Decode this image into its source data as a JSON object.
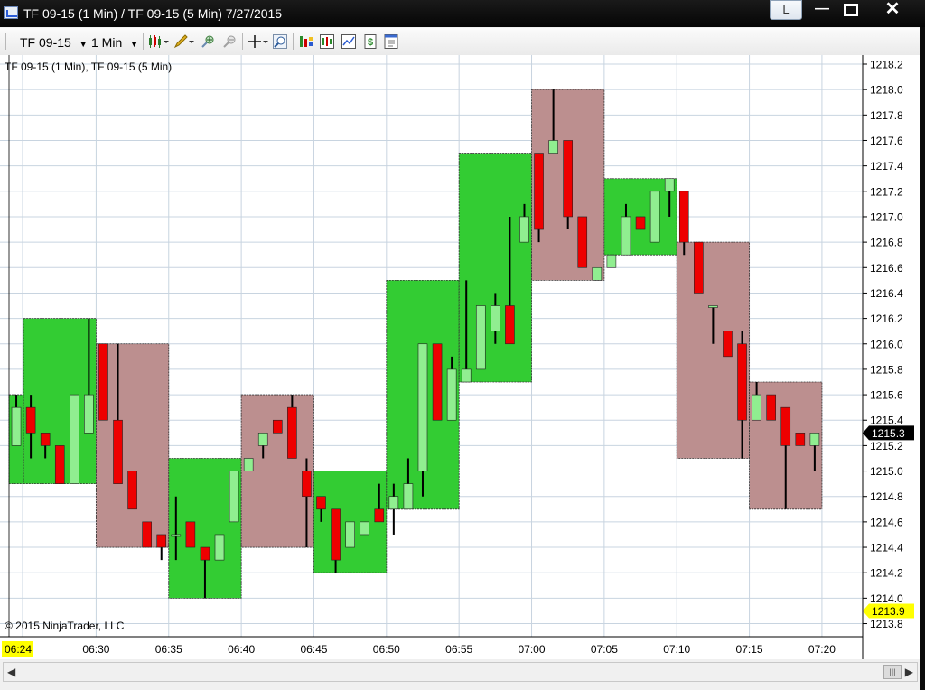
{
  "window": {
    "title": "TF 09-15 (1 Min) / TF 09-15 (5 Min)  7/27/2015",
    "l_button": "L"
  },
  "toolbar": {
    "instrument": "TF 09-15",
    "interval": "1 Min",
    "icons": [
      "chart-style-icon",
      "drawing-tools-icon",
      "zoom-in-icon",
      "zoom-out-icon",
      "crosshair-icon",
      "magnifier-icon",
      "chart-trader-icon",
      "data-box-icon",
      "indicators-icon",
      "strategies-icon",
      "properties-icon"
    ]
  },
  "chart": {
    "label": "TF 09-15 (1 Min), TF 09-15 (5 Min)",
    "copyright": "© 2015 NinjaTrader, LLC",
    "last_price_label": "1215.3",
    "marker_label": "1213.9",
    "start_time_label": "06:24",
    "colors": {
      "up_box": "#33cc33",
      "down_box": "#bc8f8f",
      "up_candle": "#90ee90",
      "down_candle": "#ee0000",
      "grid": "#c8d4e0",
      "price_tag": "#000000",
      "marker_tag": "#ffff00"
    }
  },
  "chart_data": {
    "type": "candlestick",
    "title": "",
    "y_ticks": [
      1218.2,
      1218.0,
      1217.8,
      1217.6,
      1217.4,
      1217.2,
      1217.0,
      1216.8,
      1216.6,
      1216.4,
      1216.2,
      1216.0,
      1215.8,
      1215.6,
      1215.4,
      1215.2,
      1215.0,
      1214.8,
      1214.6,
      1214.4,
      1214.2,
      1214.0,
      1213.8
    ],
    "x_ticks": [
      "06:30",
      "06:35",
      "06:40",
      "06:45",
      "06:50",
      "06:55",
      "07:00",
      "07:05",
      "07:10",
      "07:15",
      "07:20"
    ],
    "ylim": [
      1213.75,
      1218.3
    ],
    "five_min_bars": [
      {
        "start": "06:24",
        "end": "06:25",
        "open": 1214.9,
        "close": 1215.6,
        "dir": "up"
      },
      {
        "start": "06:25",
        "end": "06:30",
        "open": 1214.9,
        "close": 1216.2,
        "dir": "up"
      },
      {
        "start": "06:30",
        "end": "06:35",
        "open": 1216.0,
        "close": 1214.4,
        "dir": "down"
      },
      {
        "start": "06:35",
        "end": "06:40",
        "open": 1214.0,
        "close": 1215.1,
        "dir": "up"
      },
      {
        "start": "06:40",
        "end": "06:45",
        "open": 1215.6,
        "close": 1214.4,
        "dir": "down"
      },
      {
        "start": "06:45",
        "end": "06:50",
        "open": 1214.2,
        "close": 1215.0,
        "dir": "up"
      },
      {
        "start": "06:50",
        "end": "06:55",
        "open": 1214.7,
        "close": 1216.5,
        "dir": "up"
      },
      {
        "start": "06:55",
        "end": "07:00",
        "open": 1215.7,
        "close": 1217.5,
        "dir": "up"
      },
      {
        "start": "07:00",
        "end": "07:05",
        "open": 1218.0,
        "close": 1216.5,
        "dir": "down"
      },
      {
        "start": "07:05",
        "end": "07:10",
        "open": 1216.7,
        "close": 1217.3,
        "dir": "up"
      },
      {
        "start": "07:10",
        "end": "07:15",
        "open": 1216.8,
        "close": 1215.1,
        "dir": "down"
      },
      {
        "start": "07:15",
        "end": "07:20",
        "open": 1215.7,
        "close": 1214.7,
        "dir": "down"
      }
    ],
    "one_min_bars": [
      {
        "t": "06:24",
        "o": 1215.2,
        "h": 1215.6,
        "l": 1215.2,
        "c": 1215.5
      },
      {
        "t": "06:25",
        "o": 1215.5,
        "h": 1215.6,
        "l": 1215.1,
        "c": 1215.3
      },
      {
        "t": "06:26",
        "o": 1215.3,
        "h": 1215.3,
        "l": 1215.1,
        "c": 1215.2
      },
      {
        "t": "06:27",
        "o": 1215.2,
        "h": 1215.2,
        "l": 1214.9,
        "c": 1214.9
      },
      {
        "t": "06:28",
        "o": 1214.9,
        "h": 1215.6,
        "l": 1214.9,
        "c": 1215.6
      },
      {
        "t": "06:29",
        "o": 1215.3,
        "h": 1216.2,
        "l": 1215.3,
        "c": 1215.6
      },
      {
        "t": "06:30",
        "o": 1216.0,
        "h": 1216.0,
        "l": 1215.4,
        "c": 1215.4
      },
      {
        "t": "06:31",
        "o": 1215.4,
        "h": 1216.0,
        "l": 1214.9,
        "c": 1214.9
      },
      {
        "t": "06:32",
        "o": 1215.0,
        "h": 1215.0,
        "l": 1214.7,
        "c": 1214.7
      },
      {
        "t": "06:33",
        "o": 1214.6,
        "h": 1214.6,
        "l": 1214.5,
        "c": 1214.4
      },
      {
        "t": "06:34",
        "o": 1214.5,
        "h": 1214.5,
        "l": 1214.3,
        "c": 1214.4
      },
      {
        "t": "06:35",
        "o": 1214.5,
        "h": 1214.8,
        "l": 1214.3,
        "c": 1214.5
      },
      {
        "t": "06:36",
        "o": 1214.6,
        "h": 1214.6,
        "l": 1214.4,
        "c": 1214.4
      },
      {
        "t": "06:37",
        "o": 1214.4,
        "h": 1214.4,
        "l": 1214.0,
        "c": 1214.3
      },
      {
        "t": "06:38",
        "o": 1214.3,
        "h": 1214.5,
        "l": 1214.3,
        "c": 1214.5
      },
      {
        "t": "06:39",
        "o": 1214.6,
        "h": 1215.0,
        "l": 1214.6,
        "c": 1215.0
      },
      {
        "t": "06:40",
        "o": 1215.0,
        "h": 1215.1,
        "l": 1215.0,
        "c": 1215.1
      },
      {
        "t": "06:41",
        "o": 1215.2,
        "h": 1215.3,
        "l": 1215.1,
        "c": 1215.3
      },
      {
        "t": "06:42",
        "o": 1215.4,
        "h": 1215.4,
        "l": 1215.3,
        "c": 1215.3
      },
      {
        "t": "06:43",
        "o": 1215.5,
        "h": 1215.6,
        "l": 1215.1,
        "c": 1215.1
      },
      {
        "t": "06:44",
        "o": 1215.0,
        "h": 1215.1,
        "l": 1214.4,
        "c": 1214.8
      },
      {
        "t": "06:45",
        "o": 1214.8,
        "h": 1214.8,
        "l": 1214.6,
        "c": 1214.7
      },
      {
        "t": "06:46",
        "o": 1214.7,
        "h": 1214.7,
        "l": 1214.2,
        "c": 1214.3
      },
      {
        "t": "06:47",
        "o": 1214.4,
        "h": 1214.6,
        "l": 1214.4,
        "c": 1214.6
      },
      {
        "t": "06:48",
        "o": 1214.5,
        "h": 1214.6,
        "l": 1214.5,
        "c": 1214.6
      },
      {
        "t": "06:49",
        "o": 1214.7,
        "h": 1214.9,
        "l": 1214.6,
        "c": 1214.6
      },
      {
        "t": "06:50",
        "o": 1214.7,
        "h": 1214.9,
        "l": 1214.5,
        "c": 1214.8
      },
      {
        "t": "06:51",
        "o": 1214.7,
        "h": 1215.1,
        "l": 1214.7,
        "c": 1214.9
      },
      {
        "t": "06:52",
        "o": 1215.0,
        "h": 1216.0,
        "l": 1214.8,
        "c": 1216.0
      },
      {
        "t": "06:53",
        "o": 1216.0,
        "h": 1216.0,
        "l": 1215.4,
        "c": 1215.4
      },
      {
        "t": "06:54",
        "o": 1215.4,
        "h": 1215.9,
        "l": 1215.4,
        "c": 1215.8
      },
      {
        "t": "06:55",
        "o": 1215.7,
        "h": 1216.5,
        "l": 1215.7,
        "c": 1215.8
      },
      {
        "t": "06:56",
        "o": 1215.8,
        "h": 1216.3,
        "l": 1215.8,
        "c": 1216.3
      },
      {
        "t": "06:57",
        "o": 1216.1,
        "h": 1216.4,
        "l": 1216.0,
        "c": 1216.3
      },
      {
        "t": "06:58",
        "o": 1216.3,
        "h": 1217.0,
        "l": 1216.0,
        "c": 1216.0
      },
      {
        "t": "06:59",
        "o": 1216.8,
        "h": 1217.1,
        "l": 1216.8,
        "c": 1217.0
      },
      {
        "t": "07:00",
        "o": 1217.5,
        "h": 1217.5,
        "l": 1216.8,
        "c": 1216.9
      },
      {
        "t": "07:01",
        "o": 1217.5,
        "h": 1218.0,
        "l": 1217.5,
        "c": 1217.6
      },
      {
        "t": "07:02",
        "o": 1217.6,
        "h": 1217.6,
        "l": 1216.9,
        "c": 1217.0
      },
      {
        "t": "07:03",
        "o": 1217.0,
        "h": 1217.0,
        "l": 1216.6,
        "c": 1216.6
      },
      {
        "t": "07:04",
        "o": 1216.5,
        "h": 1216.6,
        "l": 1216.5,
        "c": 1216.6
      },
      {
        "t": "07:05",
        "o": 1216.6,
        "h": 1216.7,
        "l": 1216.6,
        "c": 1216.7
      },
      {
        "t": "07:06",
        "o": 1216.7,
        "h": 1217.1,
        "l": 1216.7,
        "c": 1217.0
      },
      {
        "t": "07:07",
        "o": 1217.0,
        "h": 1217.0,
        "l": 1216.9,
        "c": 1216.9
      },
      {
        "t": "07:08",
        "o": 1216.8,
        "h": 1217.2,
        "l": 1216.8,
        "c": 1217.2
      },
      {
        "t": "07:09",
        "o": 1217.2,
        "h": 1217.3,
        "l": 1217.0,
        "c": 1217.3
      },
      {
        "t": "07:10",
        "o": 1217.2,
        "h": 1217.2,
        "l": 1216.7,
        "c": 1216.8
      },
      {
        "t": "07:11",
        "o": 1216.8,
        "h": 1216.8,
        "l": 1216.4,
        "c": 1216.4
      },
      {
        "t": "07:12",
        "o": 1216.3,
        "h": 1216.3,
        "l": 1216.0,
        "c": 1216.3
      },
      {
        "t": "07:13",
        "o": 1216.1,
        "h": 1216.1,
        "l": 1215.9,
        "c": 1215.9
      },
      {
        "t": "07:14",
        "o": 1216.0,
        "h": 1216.1,
        "l": 1215.1,
        "c": 1215.4
      },
      {
        "t": "07:15",
        "o": 1215.4,
        "h": 1215.7,
        "l": 1215.4,
        "c": 1215.6
      },
      {
        "t": "07:16",
        "o": 1215.6,
        "h": 1215.6,
        "l": 1215.4,
        "c": 1215.4
      },
      {
        "t": "07:17",
        "o": 1215.5,
        "h": 1215.5,
        "l": 1214.7,
        "c": 1215.2
      },
      {
        "t": "07:18",
        "o": 1215.3,
        "h": 1215.3,
        "l": 1215.2,
        "c": 1215.2
      },
      {
        "t": "07:19",
        "o": 1215.2,
        "h": 1215.3,
        "l": 1215.0,
        "c": 1215.3
      }
    ]
  }
}
